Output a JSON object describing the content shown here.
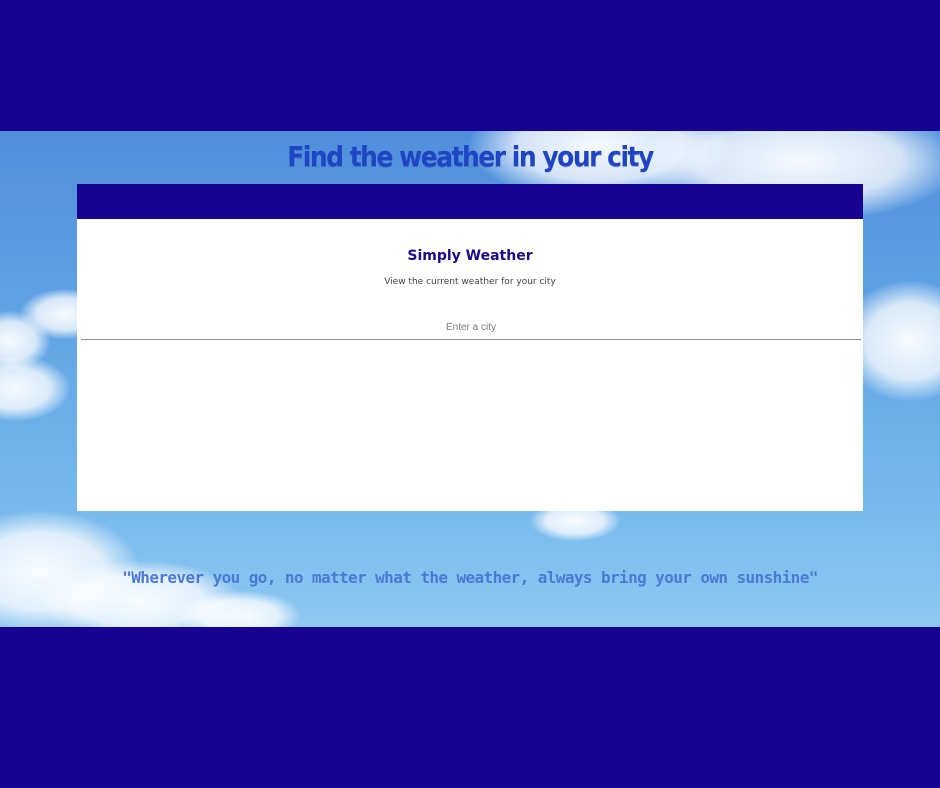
{
  "page": {
    "heading": "Find the weather in your city",
    "quote": "\"Wherever you go, no matter what the weather, always bring your own sunshine\""
  },
  "card": {
    "title": "Simply Weather",
    "subtitle": "View the current weather for your city",
    "search": {
      "placeholder": "Enter a city",
      "value": ""
    }
  },
  "colors": {
    "band": "#170390",
    "heading": "#1f45c4",
    "card_title": "#1b0a8a",
    "quote": "#4b7ad6",
    "card_background": "#ffffff"
  }
}
